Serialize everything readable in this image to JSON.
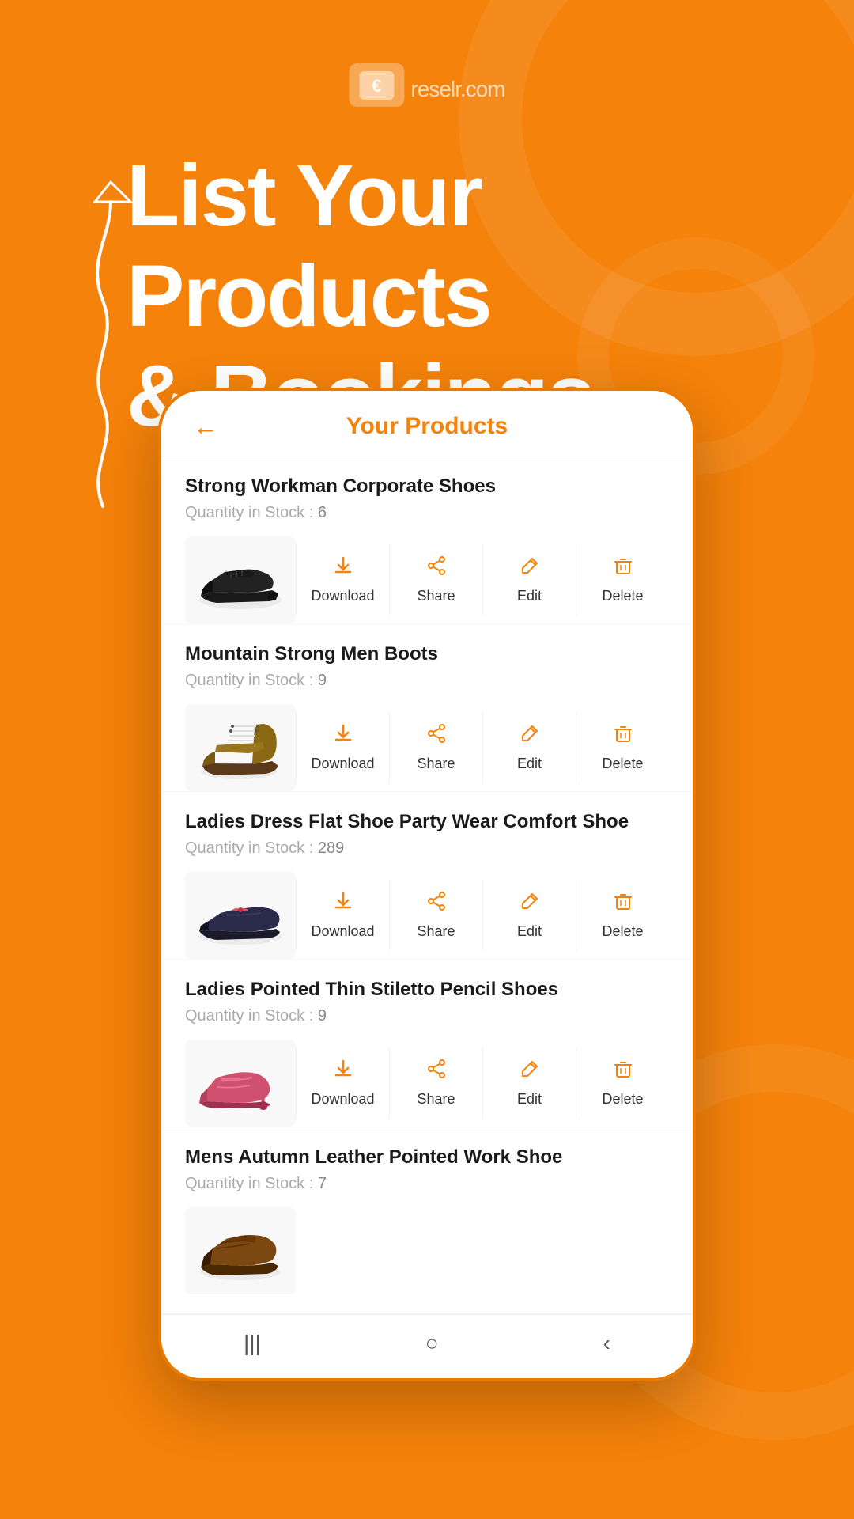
{
  "app": {
    "logo_text": "reselr",
    "logo_suffix": ".com"
  },
  "hero": {
    "line1": "List Your",
    "line2": "Products",
    "line3": "& Bookings"
  },
  "phone": {
    "header": {
      "back_label": "←",
      "title": "Your Products"
    },
    "products": [
      {
        "id": 1,
        "name": "Strong Workman Corporate Shoes",
        "stock_label": "Quantity in Stock :",
        "stock_value": "6",
        "shoe_type": "corporate"
      },
      {
        "id": 2,
        "name": "Mountain Strong Men Boots",
        "stock_label": "Quantity in Stock :",
        "stock_value": "9",
        "shoe_type": "boot"
      },
      {
        "id": 3,
        "name": "Ladies Dress Flat Shoe Party Wear Comfort Shoe",
        "stock_label": "Quantity in Stock :",
        "stock_value": "289",
        "shoe_type": "flat"
      },
      {
        "id": 4,
        "name": "Ladies Pointed Thin Stiletto Pencil Shoes",
        "stock_label": "Quantity in Stock :",
        "stock_value": "9",
        "shoe_type": "stiletto"
      },
      {
        "id": 5,
        "name": "Mens Autumn Leather Pointed Work Shoe",
        "stock_label": "Quantity in Stock :",
        "stock_value": "7",
        "shoe_type": "leather"
      }
    ],
    "actions": [
      {
        "id": "download",
        "label": "Download",
        "icon": "⬇"
      },
      {
        "id": "share",
        "label": "Share",
        "icon": "↗"
      },
      {
        "id": "edit",
        "label": "Edit",
        "icon": "✏"
      },
      {
        "id": "delete",
        "label": "Delete",
        "icon": "🗑"
      }
    ],
    "nav": {
      "items": [
        "|||",
        "○",
        "‹"
      ]
    }
  },
  "colors": {
    "primary": "#F5820A",
    "white": "#ffffff",
    "text_dark": "#1a1a1a",
    "text_gray": "#aaaaaa"
  }
}
